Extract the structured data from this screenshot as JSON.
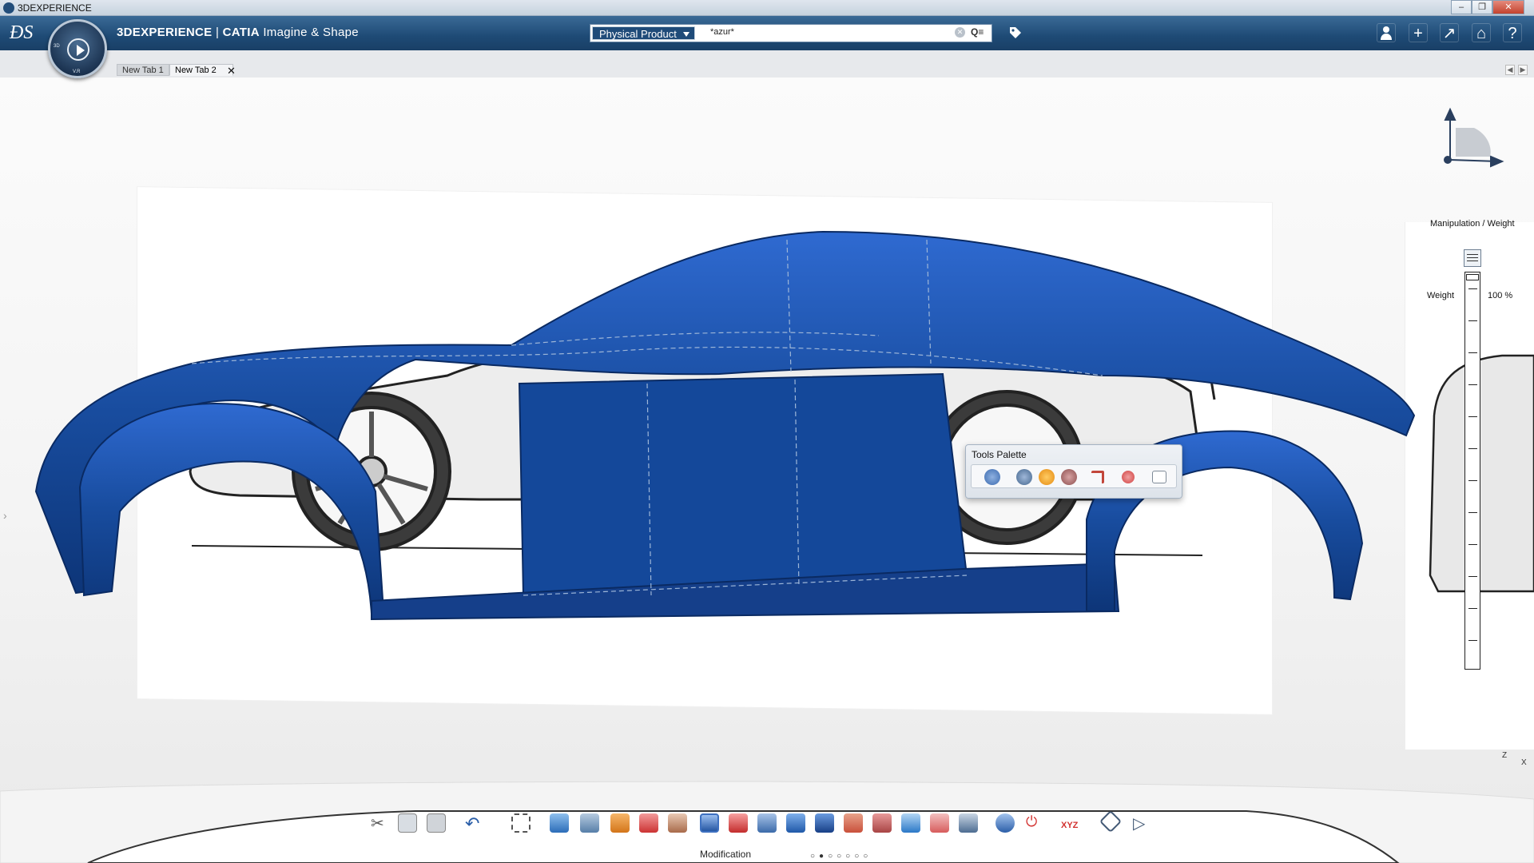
{
  "window": {
    "title": "3DEXPERIENCE"
  },
  "topbar": {
    "brand": "3DEXPERIENCE",
    "separator": "|",
    "product": "CATIA",
    "app": "Imagine & Shape",
    "compass_labels": {
      "left": "3D",
      "bottom": "V.R"
    }
  },
  "search": {
    "scope": "Physical Product",
    "query": "*azur*"
  },
  "tabs": [
    {
      "label": "New Tab 1"
    },
    {
      "label": "New Tab 2"
    }
  ],
  "tools_palette": {
    "title": "Tools Palette"
  },
  "manipulation": {
    "title": "Manipulation / Weight",
    "weight_label": "Weight",
    "weight_value": "100 %"
  },
  "bottom_toolbar": {
    "section_label": "Modification",
    "page_dots": "○●○○○○○"
  },
  "axis": {
    "z": "Z",
    "x": "X"
  },
  "colors": {
    "surface_blue": "#1b4fa3",
    "topbar": "#1e4a75",
    "palette_bg": "#e6ebf1"
  }
}
